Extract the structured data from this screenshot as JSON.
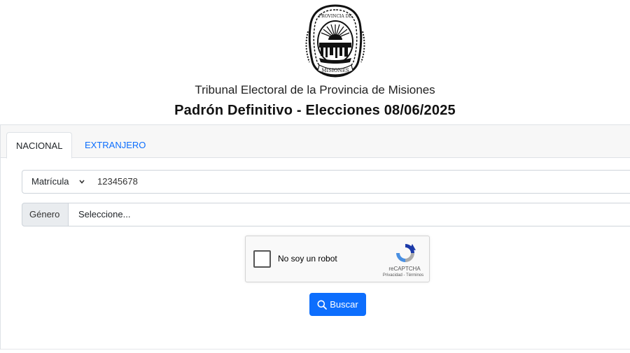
{
  "header": {
    "logo_text_top": "PROVINCIA DE",
    "logo_text_bottom": "MISIONES",
    "org_title": "Tribunal Electoral de la Provincia de Misiones",
    "page_title": "Padrón Definitivo - Elecciones 08/06/2025"
  },
  "tabs": [
    {
      "label": "NACIONAL",
      "active": true
    },
    {
      "label": "EXTRANJERO",
      "active": false
    }
  ],
  "form": {
    "doc_type_selected": "Matrícula",
    "doc_number_value": "12345678",
    "gender_addon": "Género",
    "gender_selected": "Seleccione..."
  },
  "recaptcha": {
    "label": "No soy un robot",
    "brand": "reCAPTCHA",
    "terms": "Privacidad - Términos"
  },
  "search_button": {
    "label": "Buscar",
    "icon": "search-icon"
  },
  "colors": {
    "primary": "#0d6efd",
    "tab_header_bg": "#f7f7f7",
    "addon_bg": "#e9ecef"
  }
}
